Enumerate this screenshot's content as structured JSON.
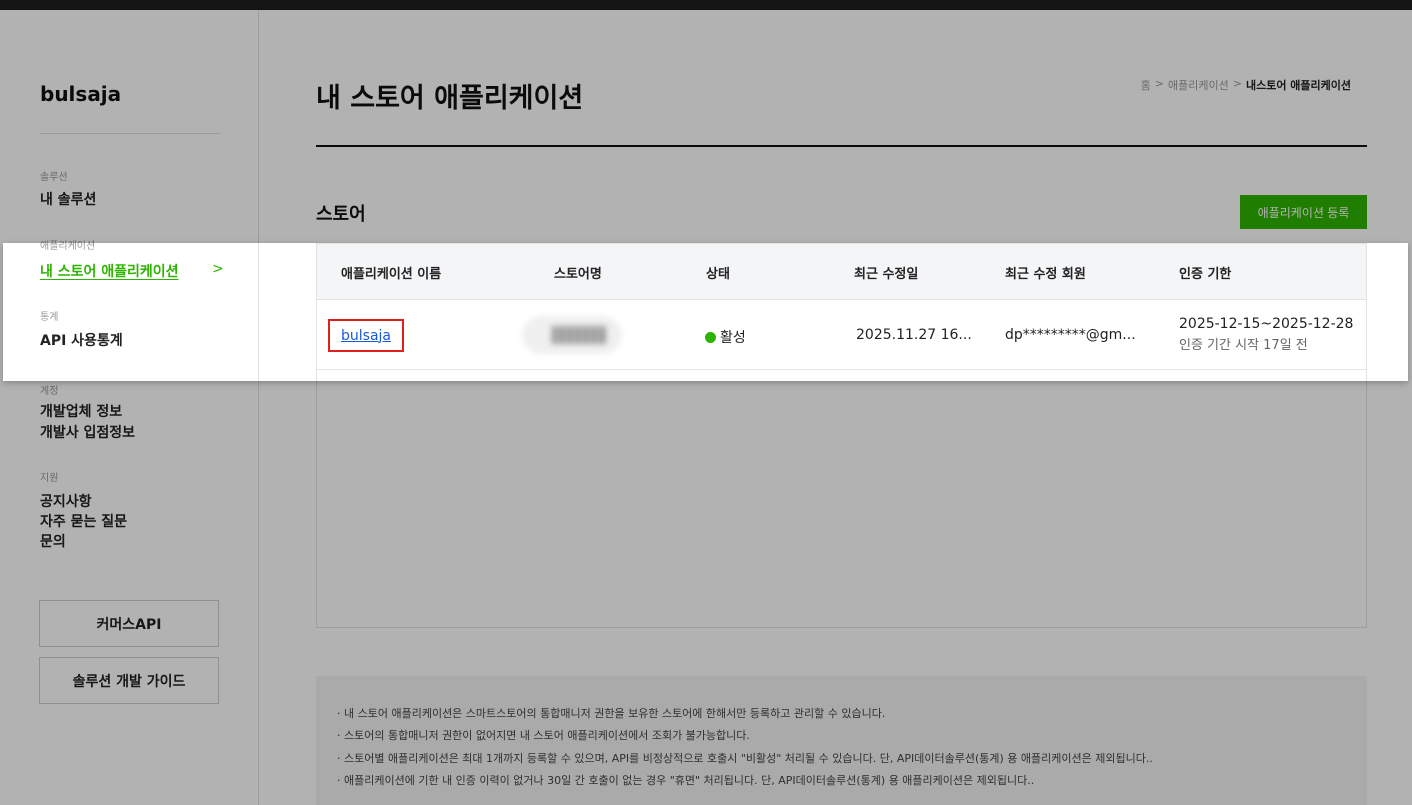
{
  "sidebar": {
    "logo": "bulsaja",
    "sections": [
      {
        "label": "솔루션",
        "items": [
          "내 솔루션"
        ]
      },
      {
        "label": "애플리케이션",
        "items": [
          "내 스토어 애플리케이션"
        ]
      },
      {
        "label": "통계",
        "items": [
          "API 사용통계"
        ]
      },
      {
        "label": "계정",
        "items": [
          "개발업체 정보",
          "개발사 입점정보"
        ]
      },
      {
        "label": "지원",
        "items": [
          "공지사항",
          "자주 묻는 질문",
          "문의"
        ]
      }
    ],
    "active_chevron": ">",
    "buttons": [
      "커머스API",
      "솔루션 개발 가이드"
    ]
  },
  "header": {
    "title": "내 스토어 애플리케이션",
    "breadcrumb": [
      "홈",
      ">",
      "애플리케이션",
      ">",
      "내스토어 애플리케이션"
    ]
  },
  "store": {
    "section_title": "스토어",
    "register_label": "애플리케이션 등록",
    "columns": [
      "애플리케이션 이름",
      "스토어명",
      "상태",
      "최근 수정일",
      "최근 수정 회원",
      "인증 기한"
    ],
    "rows": [
      {
        "app_name": "bulsaja",
        "store_name": "",
        "status": "활성",
        "modified": "2025.11.27 16...",
        "member": "dp*********@gm...",
        "auth_period": "2025-12-15~2025-12-28",
        "auth_note": "인증 기간 시작 17일 전"
      }
    ]
  },
  "notes": [
    "· 내 스토어 애플리케이션은 스마트스토어의 통합매니저 권한을 보유한 스토어에 한해서만 등록하고 관리할 수 있습니다.",
    "· 스토어의 통합매니저 권한이 없어지면 내 스토어 애플리케이션에서 조회가 불가능합니다.",
    "· 스토어별 애플리케이션은 최대 1개까지 등록할 수 있으며, API를 비정상적으로 호출시 \"비활성\" 처리될 수 있습니다. 단, API데이터솔루션(통계) 용 애플리케이션은 제외됩니다..",
    "· 애플리케이션에 기한 내 인증 이력이 없거나 30일 간 호출이 없는 경우 \"휴면\" 처리됩니다. 단, API데이터솔루션(통계) 용 애플리케이션은 제외됩니다.."
  ],
  "colors": {
    "accent": "#2db400",
    "highlight_border": "#e0201f",
    "link": "#1a5ad8"
  }
}
